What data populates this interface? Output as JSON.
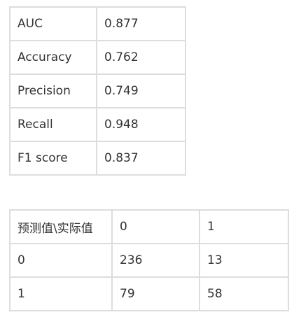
{
  "metrics_table": {
    "rows": [
      {
        "label": "AUC",
        "value": "0.877"
      },
      {
        "label": "Accuracy",
        "value": "0.762"
      },
      {
        "label": "Precision",
        "value": "0.749"
      },
      {
        "label": "Recall",
        "value": "0.948"
      },
      {
        "label": "F1 score",
        "value": "0.837"
      }
    ]
  },
  "confusion_table": {
    "header": [
      "预测值\\实际值",
      "0",
      "1"
    ],
    "rows": [
      [
        "0",
        "236",
        "13"
      ],
      [
        "1",
        "79",
        "58"
      ]
    ]
  }
}
